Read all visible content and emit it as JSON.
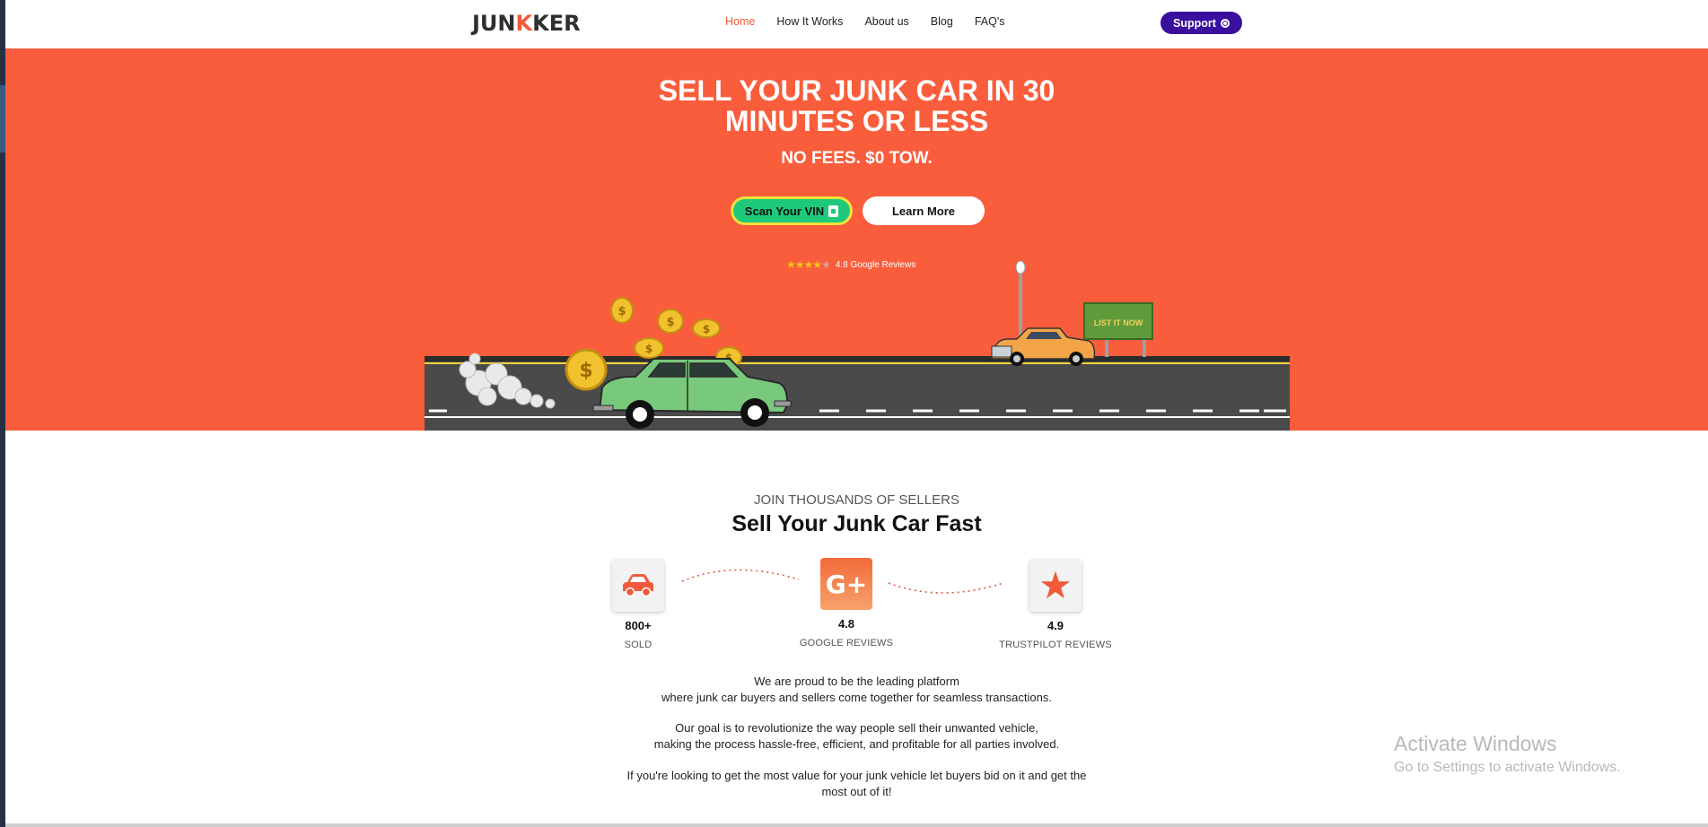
{
  "header": {
    "logo_prefix": "JUN",
    "logo_k": "K",
    "logo_suffix": "KER",
    "nav": [
      {
        "label": "Home",
        "active": true
      },
      {
        "label": "How It Works",
        "active": false
      },
      {
        "label": "About us",
        "active": false
      },
      {
        "label": "Blog",
        "active": false
      },
      {
        "label": "FAQ's",
        "active": false
      }
    ],
    "support_label": "Support"
  },
  "hero": {
    "title_line1": "SELL YOUR JUNK CAR IN 30",
    "title_line2": "MINUTES OR LESS",
    "subtitle": "NO FEES. $0 TOW.",
    "scan_button": "Scan Your VIN",
    "learn_button": "Learn More",
    "stars_filled": 4,
    "stars_total": 5,
    "rating_text": "4.8 Google Reviews",
    "sign_text": "LIST IT NOW"
  },
  "stats_section": {
    "kicker": "JOIN THOUSANDS OF SELLERS",
    "title": "Sell Your Junk Car Fast",
    "stats": [
      {
        "icon": "car-icon",
        "value": "800+",
        "label": "SOLD"
      },
      {
        "icon": "google-plus-icon",
        "value": "4.8",
        "label": "GOOGLE REVIEWS"
      },
      {
        "icon": "star-icon",
        "value": "4.9",
        "label": "TRUSTPILOT REVIEWS"
      }
    ],
    "google_plus_glyph": "G+"
  },
  "about": {
    "p1_line1": "We are proud to be the leading platform",
    "p1_line2": "where junk car buyers and sellers come together for seamless transactions.",
    "p2_line1": "Our goal is to revolutionize the way people sell their unwanted vehicle,",
    "p2_line2": "making the process hassle-free, efficient, and profitable for all parties involved.",
    "p3_line1": "If you're looking to get the most value for your junk vehicle let buyers bid on it and get the",
    "p3_line2": "most out of it!"
  },
  "watermark": {
    "line1": "Activate Windows",
    "line2": "Go to Settings to activate Windows."
  },
  "colors": {
    "brand_orange": "#f95d3c",
    "accent_purple": "#3b0f9e",
    "vin_green": "#1ec97a"
  }
}
